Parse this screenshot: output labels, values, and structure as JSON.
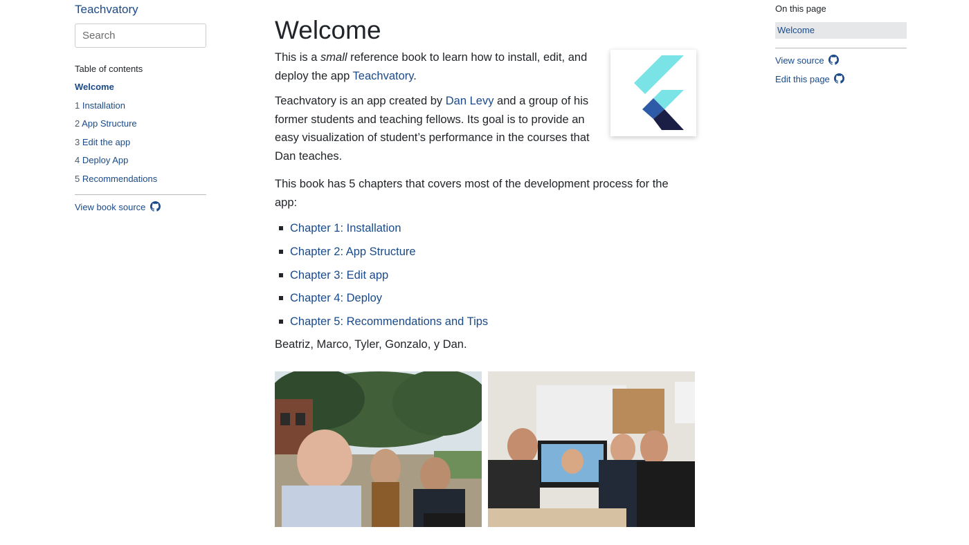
{
  "sidebar": {
    "brand": "Teachvatory",
    "search_placeholder": "Search",
    "toc_heading": "Table of contents",
    "items": [
      {
        "num": "",
        "label": "Welcome",
        "active": true
      },
      {
        "num": "1",
        "label": "Installation"
      },
      {
        "num": "2",
        "label": "App Structure"
      },
      {
        "num": "3",
        "label": "Edit the app"
      },
      {
        "num": "4",
        "label": "Deploy App"
      },
      {
        "num": "5",
        "label": "Recommendations"
      }
    ],
    "book_source": "View book source"
  },
  "main": {
    "title": "Welcome",
    "intro": {
      "before": "This is a ",
      "emph": "small",
      "middle": " reference book to learn how to install, edit, and deploy the app ",
      "link": "Teachvatory",
      "after": "."
    },
    "about": {
      "before": "Teachvatory is an app created by ",
      "link": "Dan Levy",
      "after": " and a group of his former students and teaching fellows. Its goal is to provide an easy visualization of student’s performance in the courses that Dan teaches."
    },
    "chapters_intro": "This book has 5 chapters that covers most of the development process for the app:",
    "chapters": [
      "Chapter 1: Installation",
      "Chapter 2: App Structure",
      "Chapter 3: Edit app",
      "Chapter 4: Deploy",
      "Chapter 5: Recommendations and Tips"
    ],
    "authors": "Beatriz, Marco, Tyler, Gonzalo, y Dan."
  },
  "right_toc": {
    "heading": "On this page",
    "active_item": "Welcome",
    "view_source": "View source",
    "edit_page": "Edit this page"
  },
  "colors": {
    "link": "#1a4a8a",
    "text": "#212529",
    "active_bg": "#e6e7e9"
  },
  "icons": [
    "github-icon",
    "flutter-logo"
  ]
}
